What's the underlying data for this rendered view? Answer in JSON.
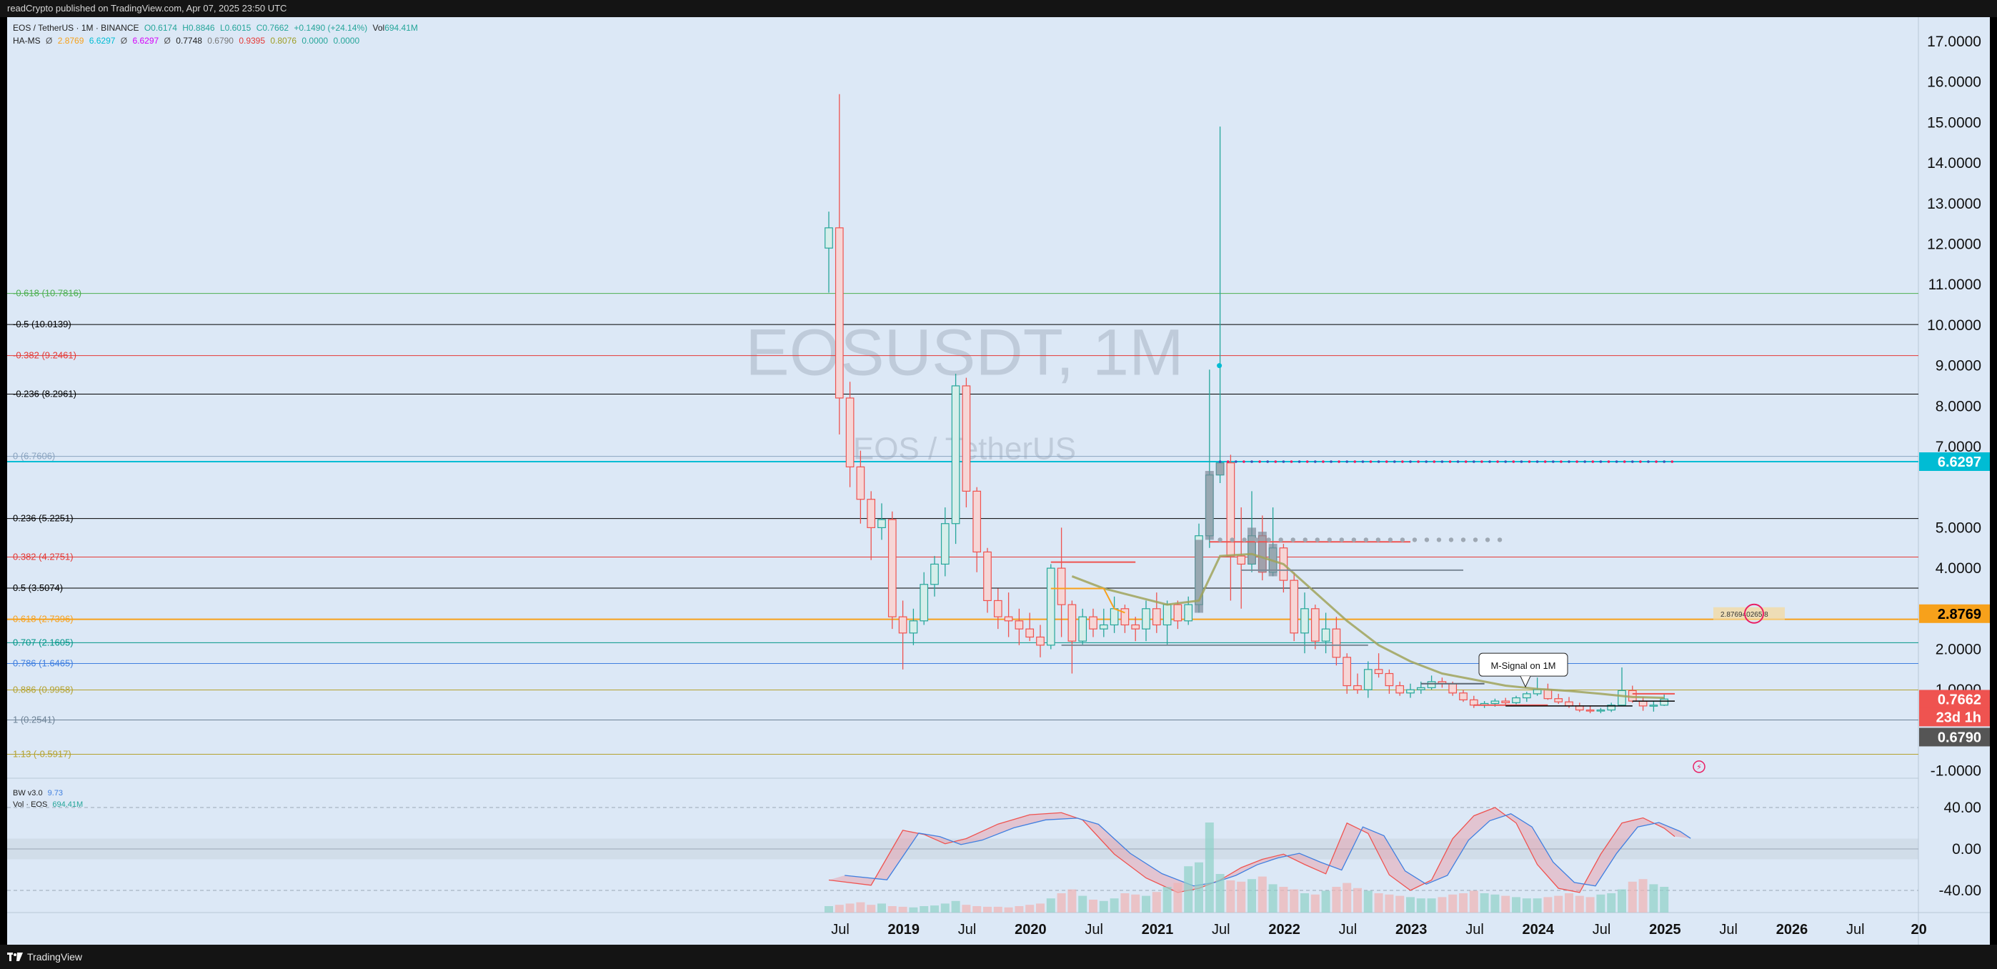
{
  "topbar": {
    "text": "readCrypto published on TradingView.com, Apr 07, 2025 23:50 UTC"
  },
  "footer": {
    "brand": "TradingView"
  },
  "legend": {
    "symbol": "EOS / TetherUS · 1M · BINANCE",
    "o": "O0.6174",
    "h": "H0.8846",
    "l": "L0.6015",
    "c": "C0.7662",
    "chg": "+0.1490 (+24.14%)",
    "vol_label": "Vol",
    "vol_value": "694.41M",
    "ha_name": "HA-MS",
    "ha_values": [
      "Ø",
      "2.8769",
      "6.6297",
      "Ø",
      "6.6297",
      "Ø",
      "0.7748",
      "0.6790",
      "0.9395",
      "0.8076",
      "0.0000",
      "0.0000"
    ]
  },
  "lower_legend": {
    "bw_name": "BW v3.0",
    "bw_value": "9.73",
    "vol_name": "Vol · EOS",
    "vol_value": "694.41M"
  },
  "watermark": {
    "title": "EOSUSDT, 1M",
    "subtitle": "EOS / TetherUS"
  },
  "colors": {
    "up": "#26a69a",
    "down": "#ef5350",
    "bg": "#dce8f6",
    "fib_orange": "#f7a11b",
    "cyan": "#00bcd4"
  },
  "price_axis": {
    "ticks": [
      "17.0000",
      "16.0000",
      "15.0000",
      "14.0000",
      "13.0000",
      "12.0000",
      "11.0000",
      "10.0000",
      "9.0000",
      "8.0000",
      "7.0000",
      "5.0000",
      "4.0000",
      "2.0000",
      "1.0000",
      "-1.0000"
    ],
    "tick_values": [
      17,
      16,
      15,
      14,
      13,
      12,
      11,
      10,
      9,
      8,
      7,
      5,
      4,
      2,
      1,
      -1
    ],
    "badges": [
      {
        "text": "6.6297",
        "value": 6.6297,
        "bg": "#00bcd4",
        "fg": "#ffffff"
      },
      {
        "text": "2.8769",
        "value": 2.8769,
        "bg": "#f7a11b",
        "fg": "#000000"
      },
      {
        "text": "0.7662",
        "value": 0.7662,
        "bg": "#ef5350",
        "fg": "#ffffff"
      },
      {
        "text": "23d 1h",
        "value": 0.33,
        "bg": "#ef5350",
        "fg": "#ffffff"
      },
      {
        "text": "0.6790",
        "value": 0.679,
        "bg": "#555555",
        "fg": "#ffffff"
      }
    ]
  },
  "osc_axis": {
    "ticks": [
      "40.00",
      "0.00",
      "-40.00"
    ],
    "tick_values": [
      40,
      0,
      -40
    ]
  },
  "time_axis": {
    "labels": [
      "Jul",
      "2019",
      "Jul",
      "2020",
      "Jul",
      "2021",
      "Jul",
      "2022",
      "Jul",
      "2023",
      "Jul",
      "2024",
      "Jul",
      "2025",
      "Jul",
      "2026",
      "Jul",
      "20"
    ],
    "bold": [
      false,
      true,
      false,
      true,
      false,
      true,
      false,
      true,
      false,
      true,
      false,
      true,
      false,
      true,
      false,
      true,
      false,
      true
    ]
  },
  "fib_levels": [
    {
      "label": "-0.618 (10.7816)",
      "value": 10.7816,
      "color": "#4caf50"
    },
    {
      "label": "-0.5 (10.0139)",
      "value": 10.0139,
      "color": "#000000"
    },
    {
      "label": "-0.382 (9.2461)",
      "value": 9.2461,
      "color": "#e53935"
    },
    {
      "label": "-0.236 (8.2961)",
      "value": 8.2961,
      "color": "#000000"
    },
    {
      "label": "0 (6.7606)",
      "value": 6.7606,
      "color": "#8aa4c0"
    },
    {
      "label": "0.236 (5.2251)",
      "value": 5.2251,
      "color": "#000000"
    },
    {
      "label": "0.382 (4.2751)",
      "value": 4.2751,
      "color": "#e53935"
    },
    {
      "label": "0.5 (3.5074)",
      "value": 3.5074,
      "color": "#000000"
    },
    {
      "label": "0.618 (2.7396)",
      "value": 2.7396,
      "color": "#f7a11b"
    },
    {
      "label": "0.707 (2.1605)",
      "value": 2.1605,
      "color": "#009688"
    },
    {
      "label": "0.786 (1.6465)",
      "value": 1.6465,
      "color": "#3f7fe0"
    },
    {
      "label": "0.886 (0.9958)",
      "value": 0.9958,
      "color": "#b5a22e"
    },
    {
      "label": "1 (0.2541)",
      "value": 0.2541,
      "color": "#6d8296"
    },
    {
      "label": "1.13 (-0.5917)",
      "value": -0.5917,
      "color": "#b5a22e"
    }
  ],
  "annotations": {
    "msignal": "M-Signal on 1M",
    "hline_label": "2.876940265 8"
  }
}
